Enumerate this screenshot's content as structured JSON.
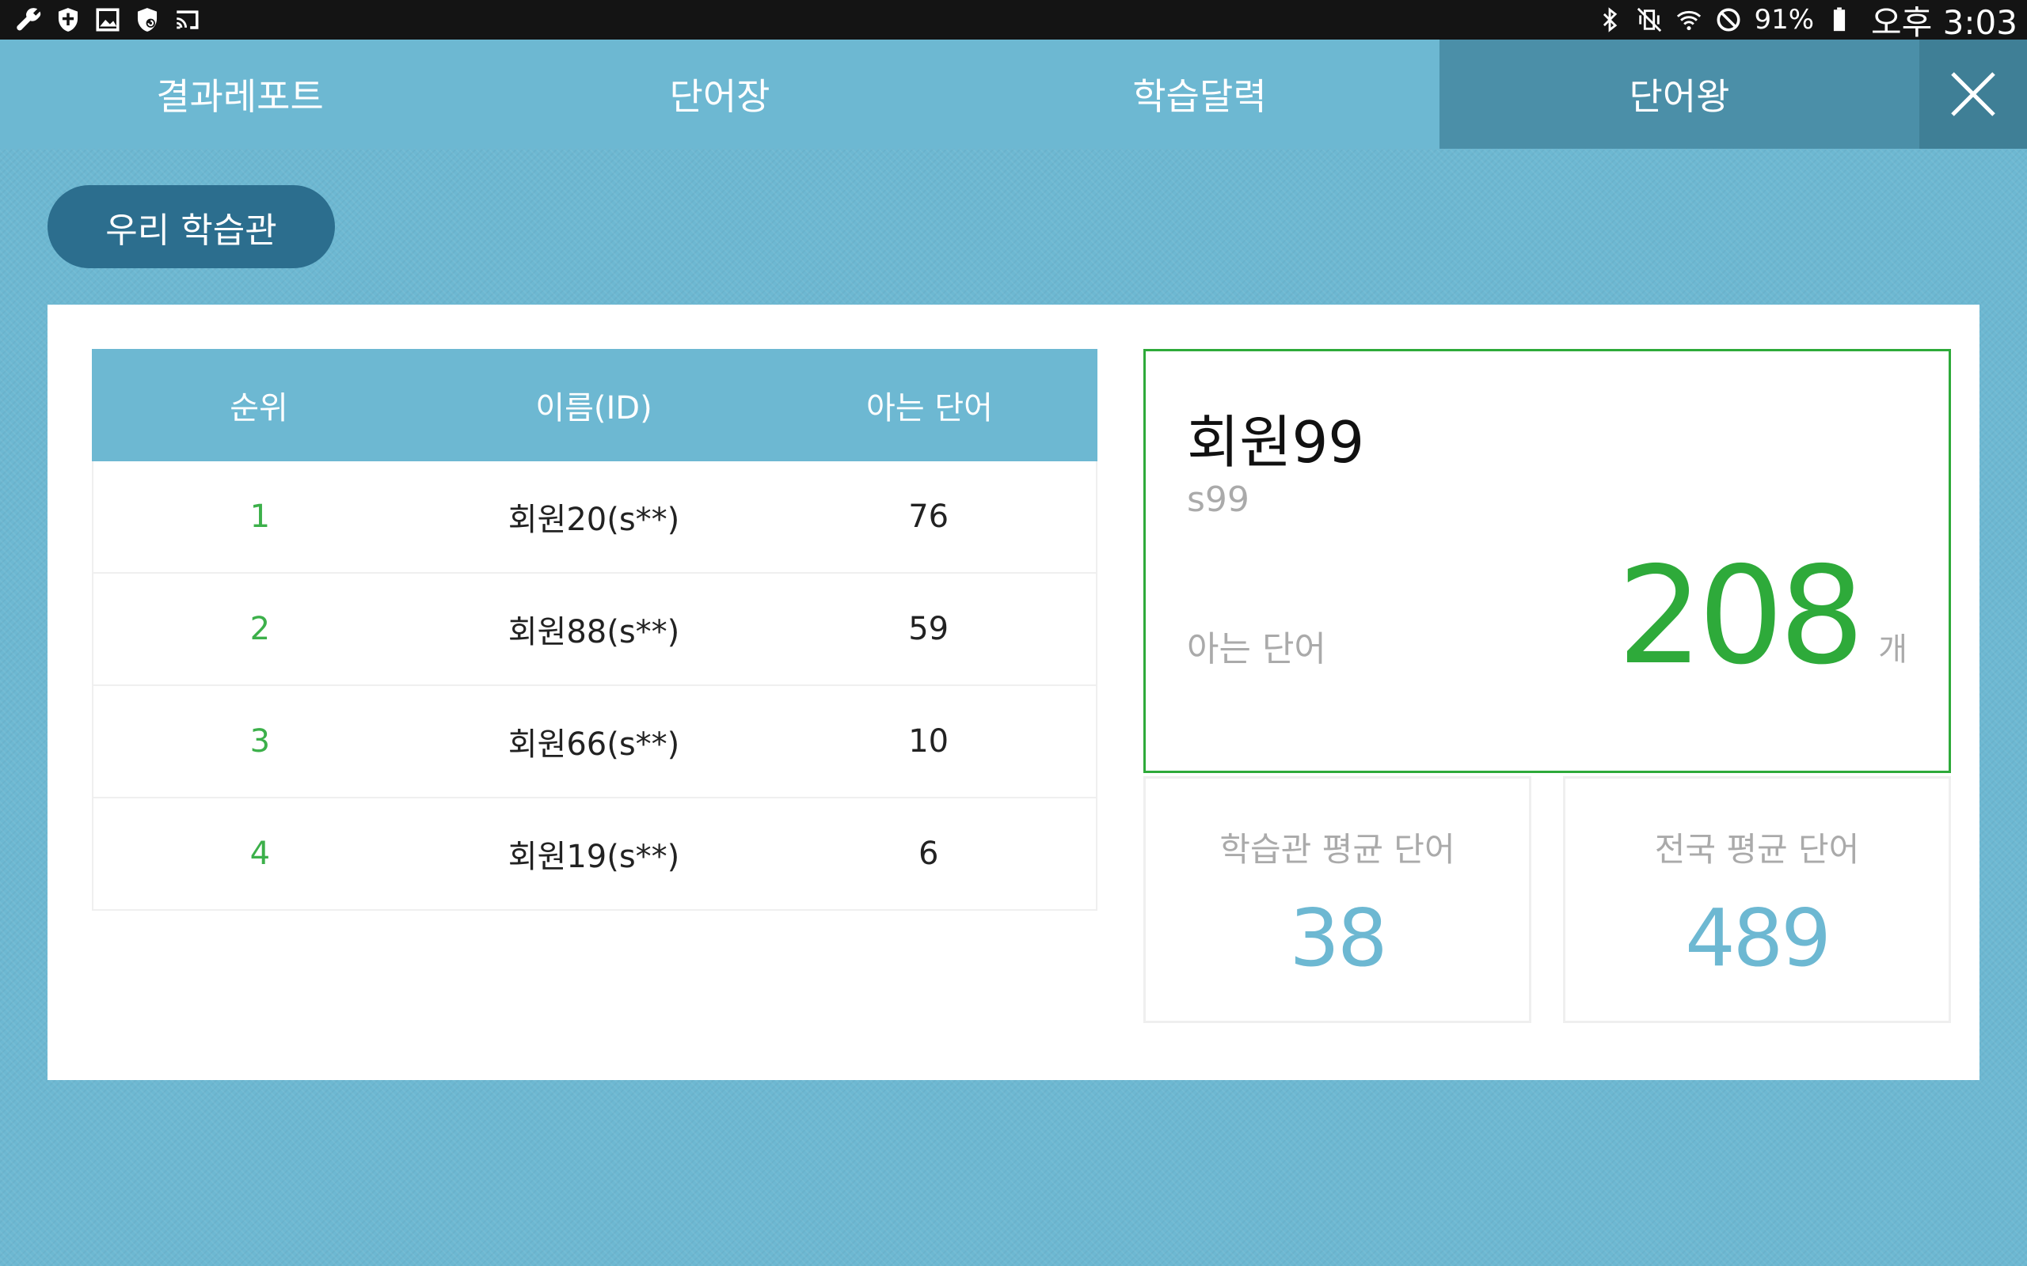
{
  "status_bar": {
    "left_icons": [
      "wrench-icon",
      "shield-icon",
      "image-icon",
      "shield-refresh-icon",
      "screen-cast-icon"
    ],
    "right_icons": [
      "bluetooth-icon",
      "vibrate-off-icon",
      "wifi-icon",
      "blocked-icon",
      "battery-icon"
    ],
    "battery": "91%",
    "time": "오후 3:03"
  },
  "tabs": [
    {
      "label": "결과레포트",
      "active": false
    },
    {
      "label": "단어장",
      "active": false
    },
    {
      "label": "학습달력",
      "active": false
    },
    {
      "label": "단어왕",
      "active": true
    }
  ],
  "filter": {
    "label": "우리 학습관"
  },
  "ranking": {
    "headers": {
      "rank": "순위",
      "name": "이름(ID)",
      "words": "아는 단어"
    },
    "rows": [
      {
        "rank": "1",
        "name": "회원20(s**)",
        "words": "76"
      },
      {
        "rank": "2",
        "name": "회원88(s**)",
        "words": "59"
      },
      {
        "rank": "3",
        "name": "회원66(s**)",
        "words": "10"
      },
      {
        "rank": "4",
        "name": "회원19(s**)",
        "words": "6"
      }
    ]
  },
  "my_stats": {
    "name": "회원99",
    "id": "s99",
    "label": "아는 단어",
    "count": "208",
    "unit": "개"
  },
  "averages": {
    "academy": {
      "label": "학습관 평균 단어",
      "value": "38"
    },
    "national": {
      "label": "전국 평균 단어",
      "value": "489"
    }
  },
  "colors": {
    "background": "#6db8d2",
    "active_tab": "#4b8fa8",
    "pill": "#2c6e8e",
    "accent_green": "#2eaa3a",
    "accent_blue": "#6db8d2"
  }
}
